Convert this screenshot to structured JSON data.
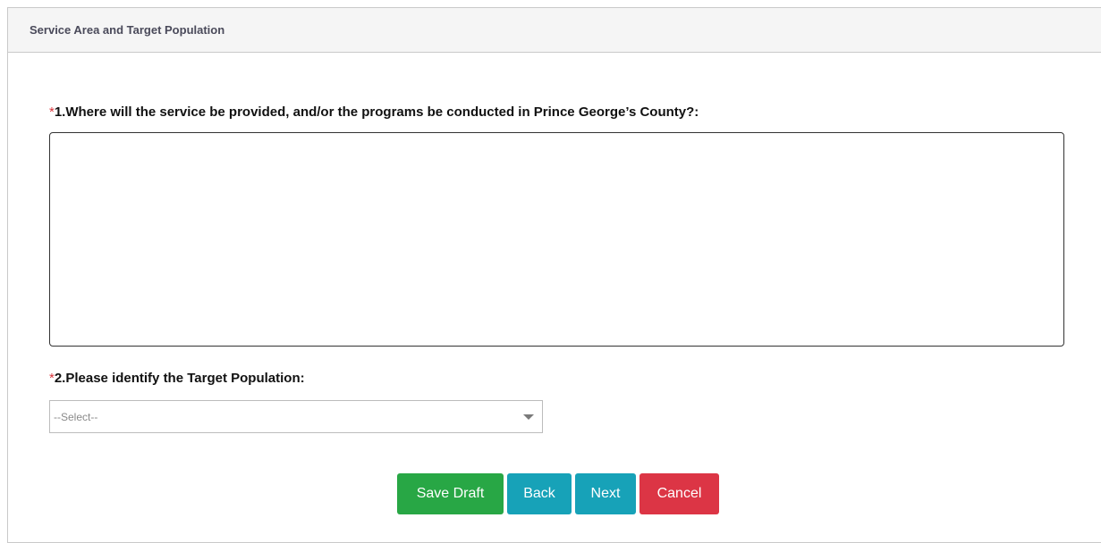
{
  "panel": {
    "title": "Service Area and Target Population"
  },
  "questions": [
    {
      "required_mark": "*",
      "text": "1.Where will the service be provided, and/or the programs be conducted in Prince George’s County?:",
      "answer": ""
    },
    {
      "required_mark": "*",
      "text": "2.Please identify the Target Population:",
      "selected": "--Select--"
    }
  ],
  "buttons": {
    "save_draft": "Save Draft",
    "back": "Back",
    "next": "Next",
    "cancel": "Cancel"
  },
  "colors": {
    "save_draft": "#28a745",
    "back": "#17a2b8",
    "next": "#17a2b8",
    "cancel": "#dc3545",
    "required": "#d9343a"
  }
}
